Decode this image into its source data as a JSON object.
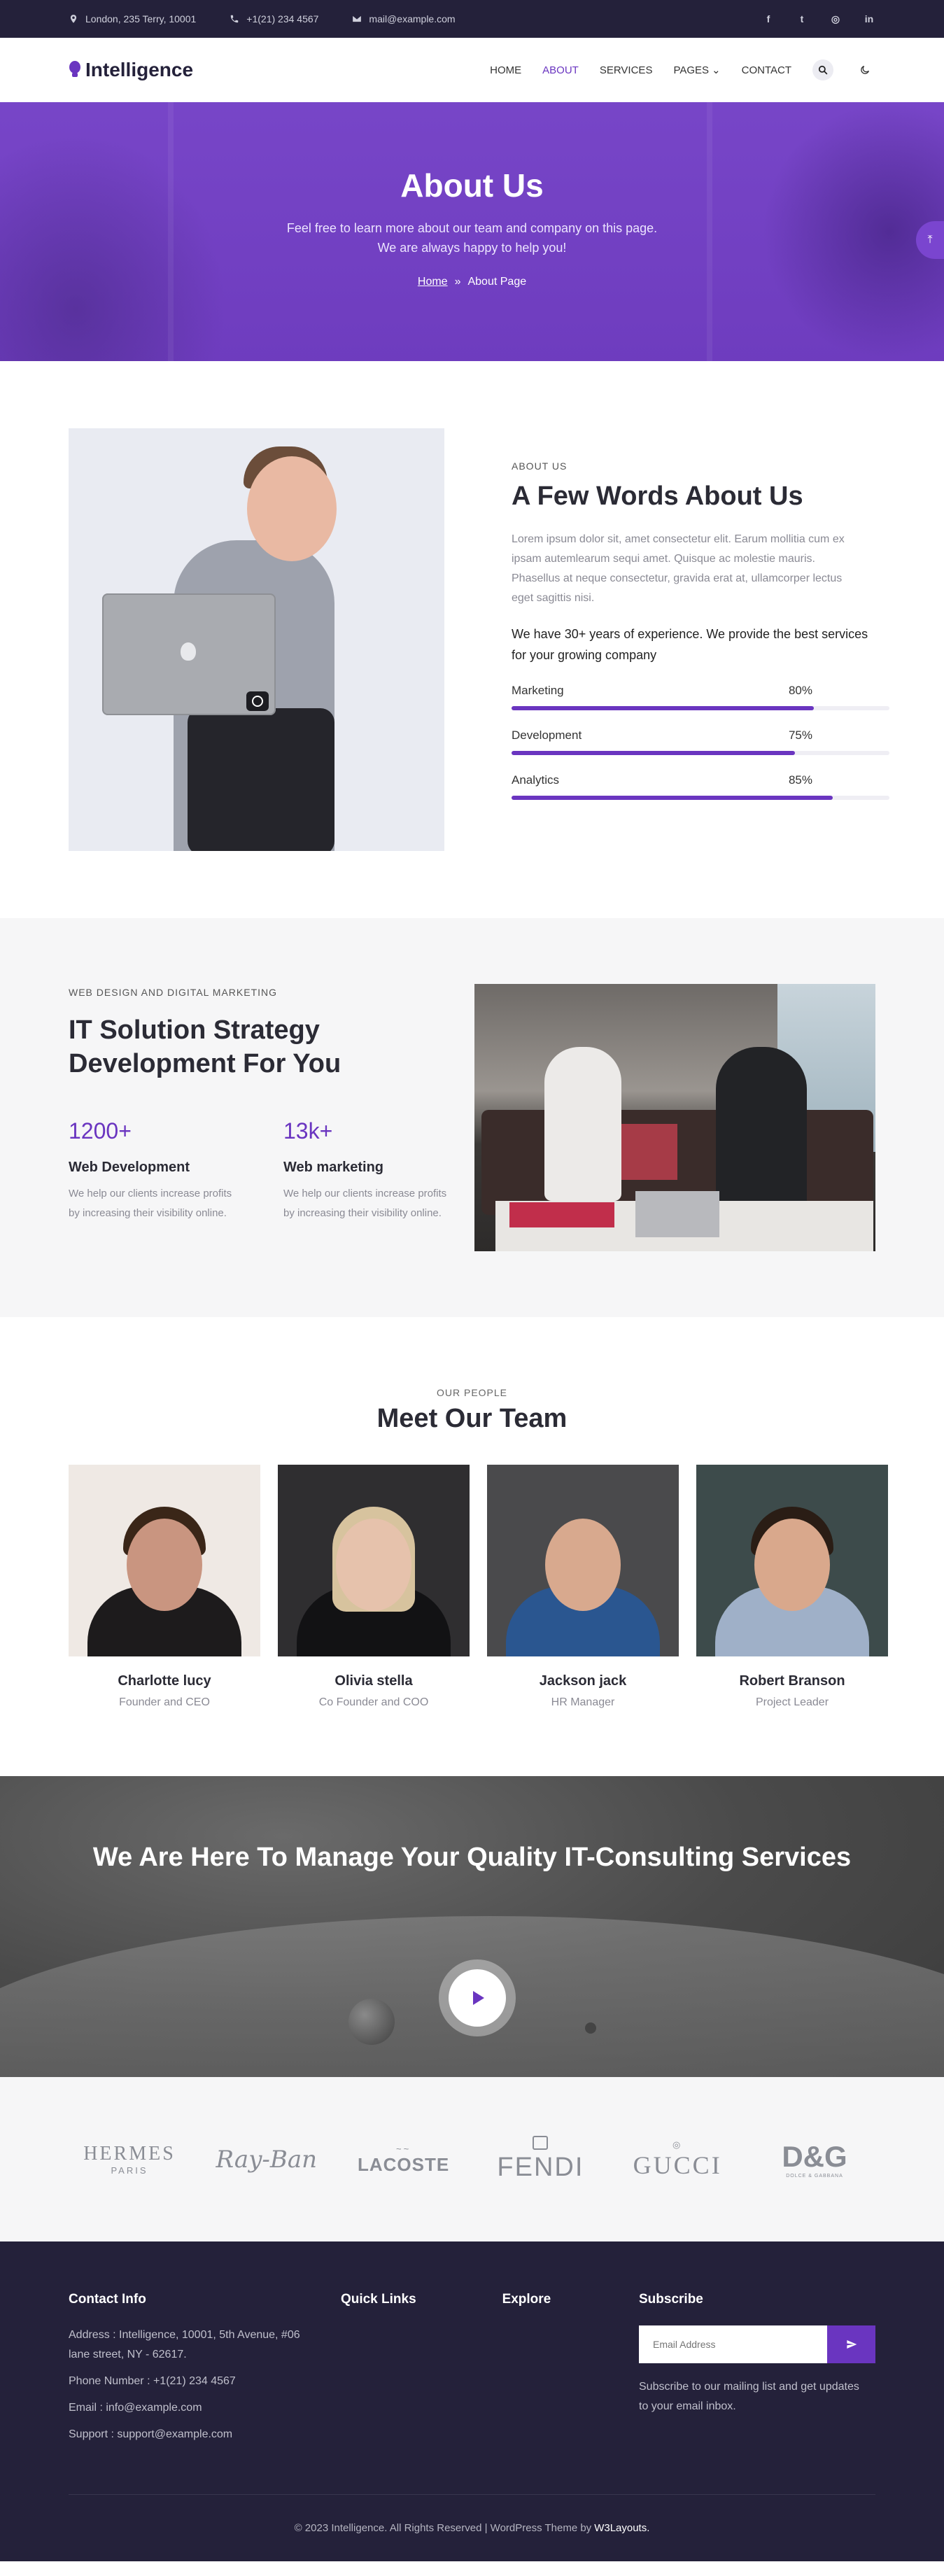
{
  "topbar": {
    "address": "London, 235 Terry, 10001",
    "phone": "+1(21) 234 4567",
    "email": "mail@example.com",
    "social_icons": [
      "facebook-icon",
      "twitter-icon",
      "instagram-icon",
      "linkedin-icon"
    ],
    "social_glyphs": [
      "f",
      "t",
      "◎",
      "in"
    ]
  },
  "header": {
    "logo": "Intelligence",
    "nav": [
      "HOME",
      "ABOUT",
      "SERVICES",
      "PAGES",
      "CONTACT"
    ],
    "active_nav": "ABOUT",
    "accent": "#6a35c0"
  },
  "hero": {
    "title": "About Us",
    "subtitle": "Feel free to learn more about our team and company on this page. We are always happy to help you!",
    "crumb_home": "Home",
    "crumb_sep": "»",
    "crumb_current": "About Page"
  },
  "about": {
    "eyebrow": "ABOUT US",
    "title": "A Few Words About Us",
    "text": "Lorem ipsum dolor sit, amet consectetur elit. Earum mollitia cum ex ipsam autemlearum sequi amet. Quisque ac molestie mauris. Phasellus at neque consectetur, gravida erat at, ullamcorper lectus eget sagittis nisi.",
    "lead": "We have 30+ years of experience. We provide the best services for your growing company",
    "skills": [
      {
        "label": "Marketing",
        "value": "80%",
        "percent": 80
      },
      {
        "label": "Development",
        "value": "75%",
        "percent": 75
      },
      {
        "label": "Analytics",
        "value": "85%",
        "percent": 85
      }
    ]
  },
  "solution": {
    "eyebrow": "WEB DESIGN AND DIGITAL MARKETING",
    "title": "IT Solution Strategy Development For You",
    "stats": [
      {
        "number": "1200+",
        "label": "Web Development",
        "desc": "We help our clients increase profits by increasing their visibility online."
      },
      {
        "number": "13k+",
        "label": "Web marketing",
        "desc": "We help our clients increase profits by increasing their visibility online."
      }
    ]
  },
  "team": {
    "eyebrow": "OUR PEOPLE",
    "title": "Meet Our Team",
    "members": [
      {
        "name": "Charlotte lucy",
        "role": "Founder and CEO"
      },
      {
        "name": "Olivia stella",
        "role": "Co Founder and COO"
      },
      {
        "name": "Jackson jack",
        "role": "HR Manager"
      },
      {
        "name": "Robert Branson",
        "role": "Project Leader"
      }
    ]
  },
  "banner": {
    "title": "We Are Here To Manage Your Quality IT-Consulting Services"
  },
  "brands": [
    {
      "name": "HERMES",
      "sub": "PARIS"
    },
    {
      "name": "Ray-Ban",
      "sub": ""
    },
    {
      "name": "LACOSTE",
      "sub": ""
    },
    {
      "name": "FENDI",
      "sub": ""
    },
    {
      "name": "GUCCI",
      "sub": ""
    },
    {
      "name": "D&G",
      "sub": "DOLCE & GABBANA"
    }
  ],
  "footer": {
    "contact_title": "Contact Info",
    "address": "Address : Intelligence, 10001, 5th Avenue, #06 lane street, NY - 62617.",
    "phone": "Phone Number : +1(21) 234 4567",
    "email": "Email : info@example.com",
    "support": "Support : support@example.com",
    "quick_links_title": "Quick Links",
    "explore_title": "Explore",
    "subscribe_title": "Subscribe",
    "subscribe_placeholder": "Email Address",
    "subscribe_text": "Subscribe to our mailing list and get updates to your email inbox.",
    "copyright": "© 2023 Intelligence. All Rights Reserved | WordPress Theme by",
    "credit": "W3Layouts."
  }
}
